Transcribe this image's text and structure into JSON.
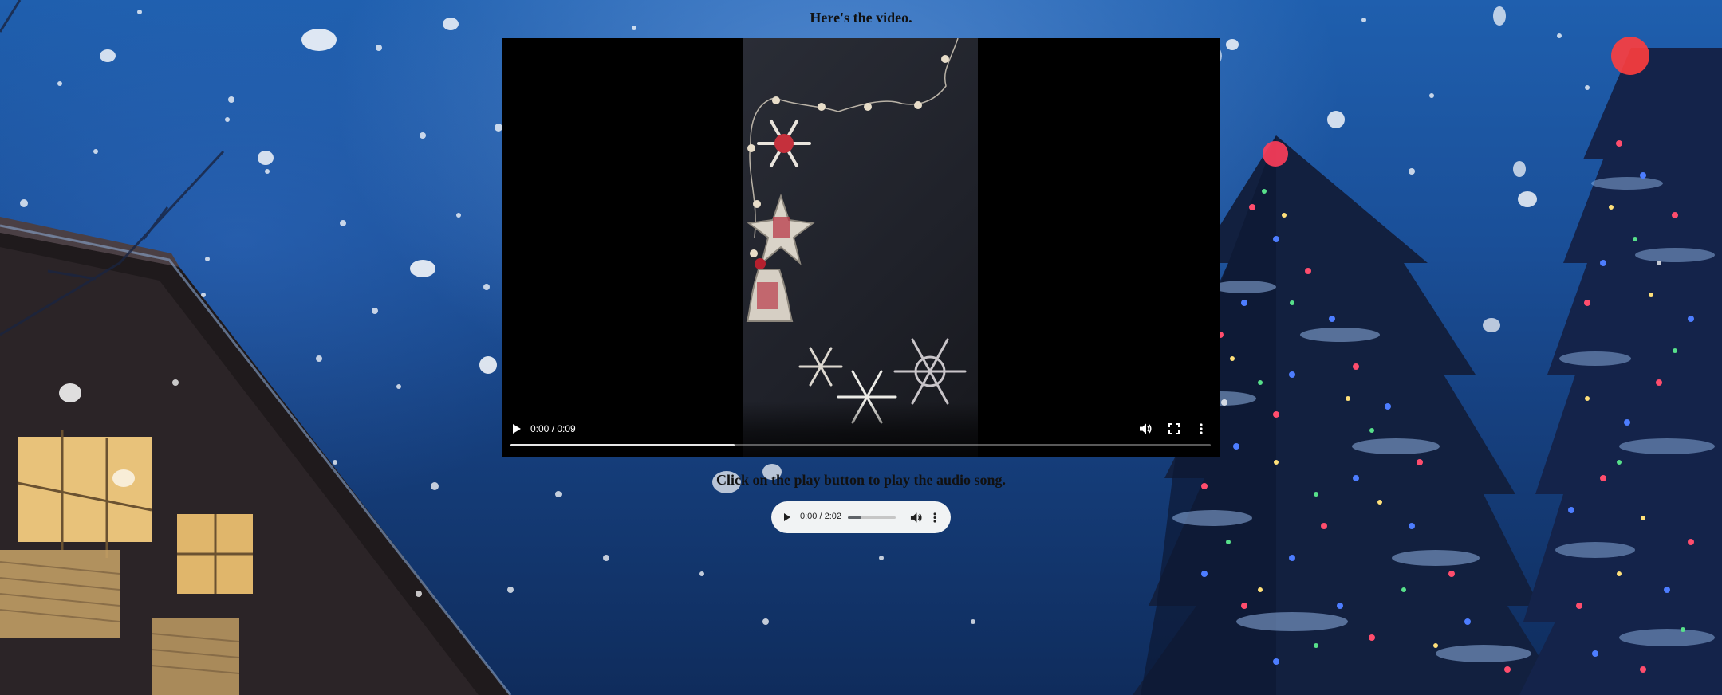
{
  "page": {
    "video_heading": "Here's the video.",
    "audio_heading": "Click on the play button to play the audio song."
  },
  "video_player": {
    "time": "0:00 / 0:09",
    "buffered_fraction": 0.32,
    "icons": [
      "play-icon",
      "volume-icon",
      "fullscreen-icon",
      "more-options-icon"
    ]
  },
  "audio_player": {
    "time": "0:00 / 2:02",
    "buffered_fraction": 0.28,
    "icons": [
      "play-icon",
      "volume-icon",
      "more-options-icon"
    ]
  },
  "colors": {
    "heading_text": "#111111",
    "sky": "#1a4f98",
    "control_bar_light": "#f1f3f4"
  }
}
